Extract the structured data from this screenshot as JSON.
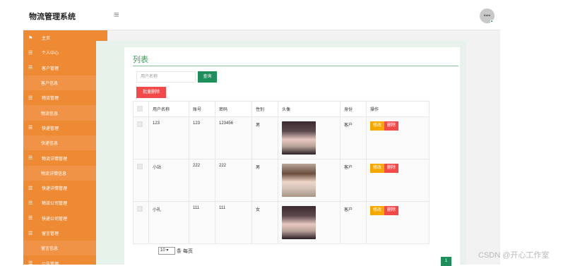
{
  "header": {
    "brand": "物流管理系统",
    "avatar_text": "Kohi"
  },
  "sidebar": {
    "items": [
      {
        "label": "主页",
        "type": "parent",
        "icon": "flag",
        "caret": ""
      },
      {
        "label": "个人中心",
        "type": "parent",
        "icon": "menu",
        "caret": "▾"
      },
      {
        "label": "客户管理",
        "type": "parent",
        "icon": "menu",
        "caret": "▴"
      },
      {
        "label": "客户信息",
        "type": "child"
      },
      {
        "label": "物流管理",
        "type": "parent",
        "icon": "menu",
        "caret": "▴"
      },
      {
        "label": "物流信息",
        "type": "child"
      },
      {
        "label": "快递管理",
        "type": "parent",
        "icon": "menu",
        "caret": "▴"
      },
      {
        "label": "快递信息",
        "type": "child"
      },
      {
        "label": "物流详情管理",
        "type": "parent",
        "icon": "menu",
        "caret": "▴"
      },
      {
        "label": "物流详情信息",
        "type": "child"
      },
      {
        "label": "快递详情管理",
        "type": "parent",
        "icon": "menu",
        "caret": "▾"
      },
      {
        "label": "物流公司管理",
        "type": "parent",
        "icon": "menu",
        "caret": "▾"
      },
      {
        "label": "快递公司管理",
        "type": "parent",
        "icon": "menu",
        "caret": "▾"
      },
      {
        "label": "留言管理",
        "type": "parent",
        "icon": "menu",
        "caret": "▴"
      },
      {
        "label": "留言信息",
        "type": "child"
      },
      {
        "label": "公告管理",
        "type": "parent",
        "icon": "menu",
        "caret": "▴"
      }
    ]
  },
  "panel": {
    "title": "列表",
    "search_placeholder": "用户名称",
    "search_button": "查询",
    "batch_delete_button": "批量删除"
  },
  "table": {
    "headers": [
      "",
      "用户名称",
      "账号",
      "密码",
      "性别",
      "头像",
      "身份",
      "操作"
    ],
    "rows": [
      {
        "name": "123",
        "account": "123",
        "password": "123456",
        "gender": "男",
        "role": "客户",
        "photo": "girl-dark-hair"
      },
      {
        "name": "小站",
        "account": "222",
        "password": "222",
        "gender": "男",
        "role": "客户",
        "photo": "girl-light"
      },
      {
        "name": "小礼",
        "account": "111",
        "password": "111",
        "gender": "女",
        "role": "客户",
        "photo": "girl-dark-hair"
      }
    ],
    "edit_label": "修改",
    "delete_label": "删除"
  },
  "pager": {
    "page_size": "10",
    "per_page_label": "条 每页",
    "current_page": "1"
  },
  "watermark": "CSDN @开心工作室"
}
